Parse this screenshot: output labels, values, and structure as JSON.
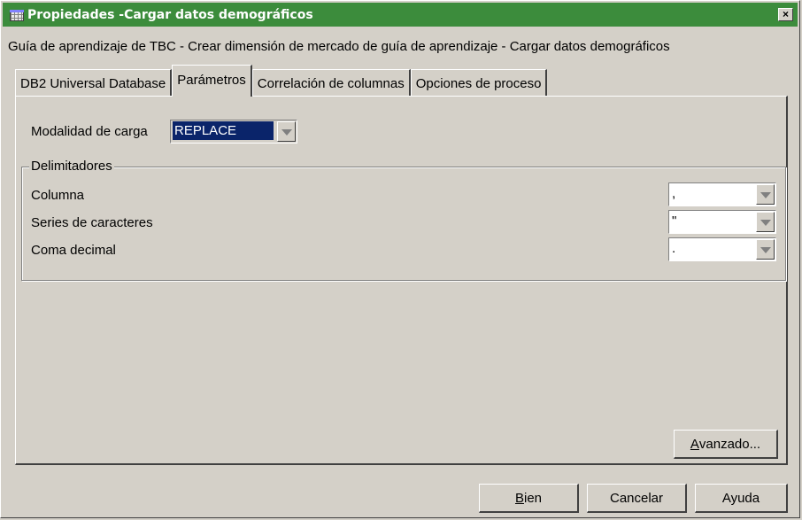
{
  "window": {
    "title": "Propiedades -Cargar datos demográficos",
    "close_label": "×",
    "app_icon": "table-grid-icon"
  },
  "subtitle": "Guía de aprendizaje de TBC - Crear dimensión de mercado de guía de aprendizaje - Cargar datos demográficos",
  "tabs": [
    {
      "label": "DB2 Universal Database",
      "active": false
    },
    {
      "label": "Parámetros",
      "active": true
    },
    {
      "label": "Correlación de columnas",
      "active": false
    },
    {
      "label": "Opciones de proceso",
      "active": false
    }
  ],
  "load_mode": {
    "label": "Modalidad de carga",
    "value": "REPLACE"
  },
  "delimiters": {
    "legend": "Delimitadores",
    "rows": [
      {
        "label": "Columna",
        "value": ","
      },
      {
        "label": "Series de caracteres",
        "value": "\""
      },
      {
        "label": "Coma decimal",
        "value": "."
      }
    ]
  },
  "buttons": {
    "advanced_prefix": "",
    "advanced_mnemonic": "A",
    "advanced_rest": "vanzado...",
    "ok_mnemonic": "B",
    "ok_rest": "ien",
    "cancel": "Cancelar",
    "help": "Ayuda"
  },
  "colors": {
    "titlebar": "#3c8c3c",
    "face": "#d4d0c8",
    "selection": "#0a246a"
  }
}
